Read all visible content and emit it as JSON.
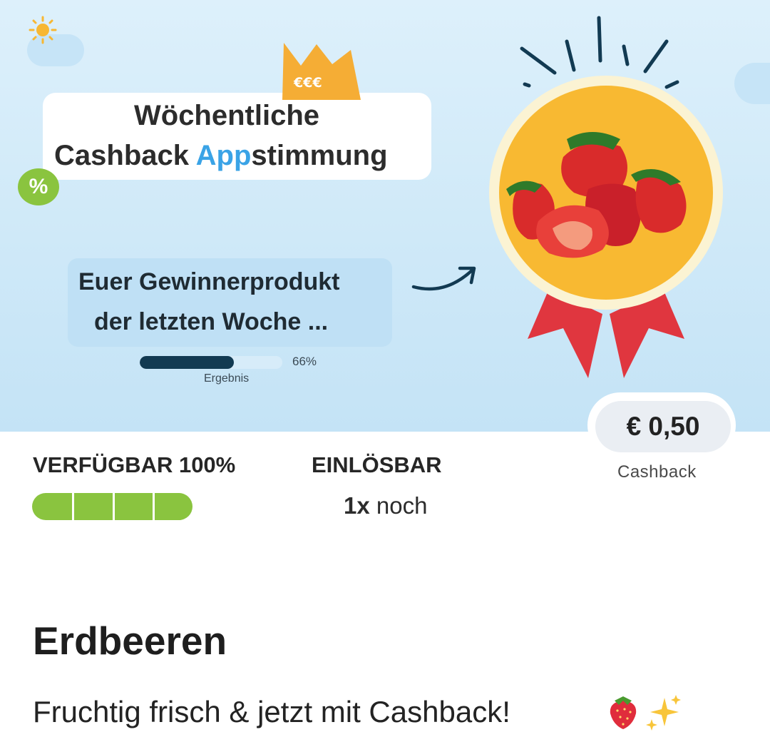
{
  "banner": {
    "title_line1": "Wöchentliche",
    "title_line2_pre": "Cashback ",
    "title_line2_accent": "App",
    "title_line2_post": "stimmung",
    "percent_badge": "%",
    "crown_coins": "€€€",
    "winner_line1": "Euer Gewinnerprodukt",
    "winner_line2": "der letzten Woche ...",
    "result_percent_text": "66%",
    "result_fraction": 0.66,
    "result_label": "Ergebnis",
    "medal_image": "strawberries",
    "colors": {
      "accent_blue": "#3aa3e6",
      "medal_orange": "#f8b932",
      "ribbon_red": "#e0363f",
      "progress_dark": "#123a52"
    }
  },
  "offer": {
    "price": "€ 0,50",
    "price_label": "Cashback",
    "availability_label": "VERFÜGBAR 100%",
    "availability_fraction": 1.0,
    "availability_segments": 4,
    "redeemable_label": "EINLÖSBAR",
    "redeemable_count": "1x",
    "redeemable_suffix": " noch",
    "accent_green": "#8ac43f"
  },
  "product": {
    "name": "Erdbeeren",
    "description": "Fruchtig frisch & jetzt mit Cashback!",
    "emojis": [
      "strawberry-emoji",
      "sparkles-emoji"
    ]
  }
}
